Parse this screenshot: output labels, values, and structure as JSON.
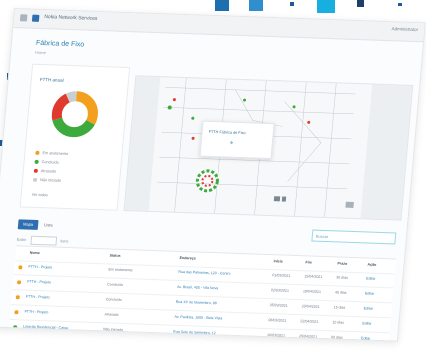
{
  "window": {
    "title": "Nokia Network Services",
    "user_menu": "Administrator"
  },
  "page": {
    "title": "Fábrica de Fixo",
    "subtitle": "Home"
  },
  "summary_card": {
    "title": "FTTH anual",
    "legend": [
      {
        "label": "Em andamento",
        "color": "#f2a01e"
      },
      {
        "label": "Concluído",
        "color": "#3daa3d"
      },
      {
        "label": "Atrasado",
        "color": "#e03a2e"
      },
      {
        "label": "Não iniciado",
        "color": "#c9ced3"
      }
    ],
    "footer": "Ver todos",
    "donut_fractions": [
      0.32,
      0.38,
      0.22,
      0.08
    ]
  },
  "map": {
    "popup_title": "FTTH Fábrica de Fixo",
    "popup_icon": "pin-icon"
  },
  "toolbar": {
    "primary_label": "Mapa",
    "secondary_label": "Lista",
    "search_placeholder": "Buscar"
  },
  "pager": {
    "show_label": "Exibir",
    "per_page_label": "itens"
  },
  "table": {
    "headers": [
      "Nome",
      "Status",
      "Endereço",
      "Início",
      "Fim",
      "Prazo",
      "Ação"
    ],
    "rows": [
      {
        "name": "FTTH - Projeto",
        "status": "Em andamento",
        "addr": "Rua das Palmeiras, 120 - Centro",
        "start": "01/03/2021",
        "end": "15/04/2021",
        "due": "30 dias",
        "act": "Editar",
        "dot": "#f2a01e"
      },
      {
        "name": "FTTH - Projeto",
        "status": "Concluído",
        "addr": "Av. Brasil, 455 - Vila Nova",
        "start": "02/03/2021",
        "end": "18/04/2021",
        "due": "45 dias",
        "act": "Editar",
        "dot": "#f2a01e"
      },
      {
        "name": "FTTH - Projeto",
        "status": "Concluído",
        "addr": "Rua XV de Novembro, 88",
        "start": "05/03/2021",
        "end": "20/04/2021",
        "due": "15 dias",
        "act": "Editar",
        "dot": "#f2a01e"
      },
      {
        "name": "FTTH - Projeto",
        "status": "Atrasado",
        "addr": "Av. Paulista, 1000 - Bela Vista",
        "start": "08/03/2021",
        "end": "22/04/2021",
        "due": "10 dias",
        "act": "Editar",
        "dot": "#f2a01e"
      },
      {
        "name": "Ligação Residencial - Caixa",
        "status": "Não iniciado",
        "addr": "Rua Sete de Setembro, 12",
        "start": "10/03/2021",
        "end": "25/04/2021",
        "due": "60 dias",
        "act": "Editar",
        "dot": "#3daa3d"
      }
    ]
  }
}
